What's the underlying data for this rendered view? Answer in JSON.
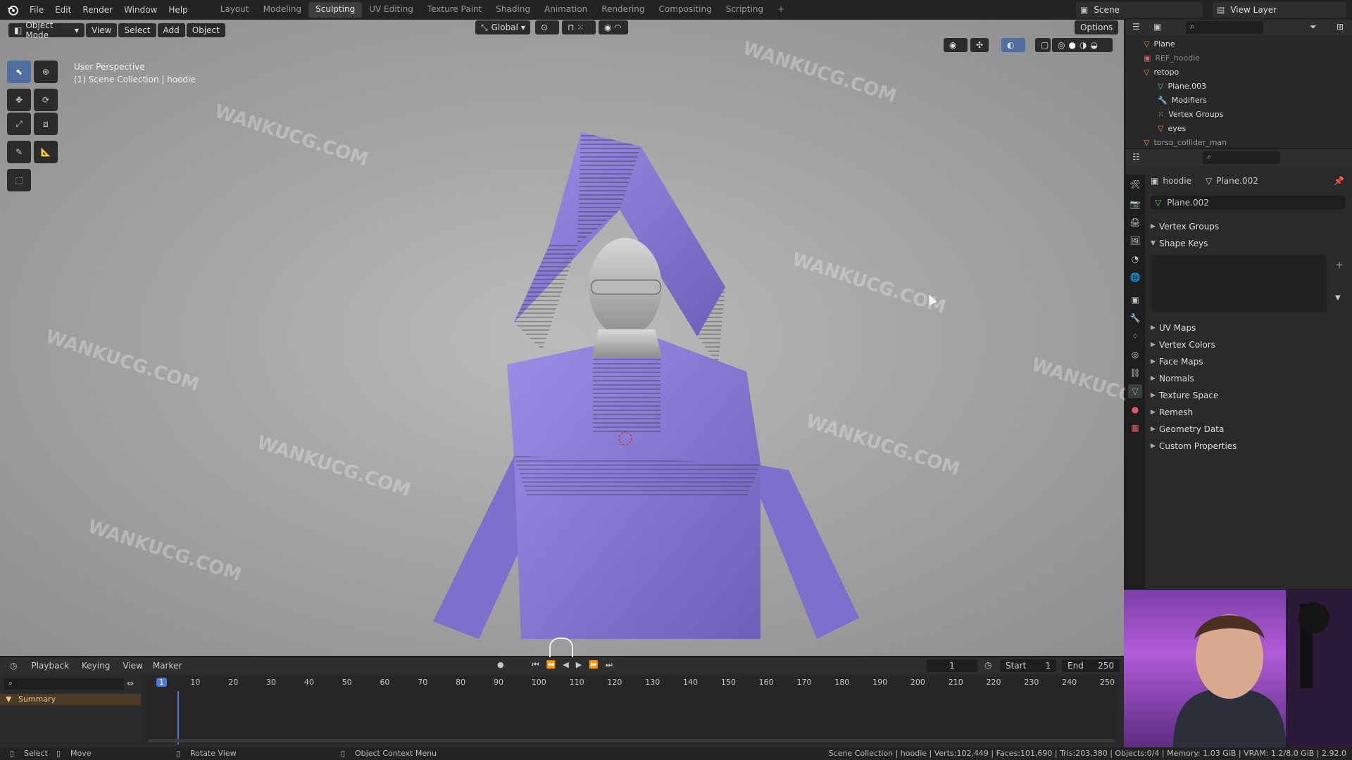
{
  "topbar": {
    "menu": [
      "File",
      "Edit",
      "Render",
      "Window",
      "Help"
    ],
    "workspaces": [
      "Layout",
      "Modeling",
      "Sculpting",
      "UV Editing",
      "Texture Paint",
      "Shading",
      "Animation",
      "Rendering",
      "Compositing",
      "Scripting"
    ],
    "active_workspace": "Sculpting",
    "add_tab": "+",
    "scene_name": "Scene",
    "view_layer": "View Layer"
  },
  "viewport": {
    "mode": "Object Mode",
    "menu": [
      "View",
      "Select",
      "Add",
      "Object"
    ],
    "transform_orientation": "Global",
    "options_label": "Options",
    "perspective_label": "User Perspective",
    "collection_label": "(1) Scene Collection | hoodie"
  },
  "outliner": {
    "rows": [
      {
        "name": "Plane"
      },
      {
        "name": "REF_hoodie"
      },
      {
        "name": "retopo"
      },
      {
        "name": "Plane.003"
      },
      {
        "name": "Modifiers"
      },
      {
        "name": "Vertex Groups"
      },
      {
        "name": "eyes"
      },
      {
        "name": "torso_collider_man"
      }
    ]
  },
  "properties": {
    "object_name": "hoodie",
    "mesh_name": "Plane.002",
    "datablock": "Plane.002",
    "sections": [
      {
        "label": "Vertex Groups",
        "open": false
      },
      {
        "label": "Shape Keys",
        "open": true
      },
      {
        "label": "UV Maps",
        "open": false
      },
      {
        "label": "Vertex Colors",
        "open": false
      },
      {
        "label": "Face Maps",
        "open": false
      },
      {
        "label": "Normals",
        "open": false
      },
      {
        "label": "Texture Space",
        "open": false
      },
      {
        "label": "Remesh",
        "open": false
      },
      {
        "label": "Geometry Data",
        "open": false
      },
      {
        "label": "Custom Properties",
        "open": false
      }
    ]
  },
  "timeline": {
    "menu": [
      "Playback",
      "Keying",
      "View",
      "Marker"
    ],
    "current_frame": "1",
    "start_label": "Start",
    "start": "1",
    "end_label": "End",
    "end": "250",
    "ruler": [
      "1",
      "10",
      "20",
      "30",
      "40",
      "50",
      "60",
      "70",
      "80",
      "90",
      "100",
      "110",
      "120",
      "130",
      "140",
      "150",
      "160",
      "170",
      "180",
      "190",
      "200",
      "210",
      "220",
      "230",
      "240",
      "250"
    ],
    "summary_label": "Summary"
  },
  "statusbar": {
    "select": "Select",
    "move": "Move",
    "rotate": "Rotate View",
    "context": "Object Context Menu",
    "stats": "Scene Collection | hoodie | Verts:102,449 | Faces:101,690 | Tris:203,380 | Objects:0/4 | Memory: 1.03 GiB | VRAM: 1.2/8.0 GiB | 2.92.0"
  },
  "watermark": "WANKUCG.COM",
  "colors": {
    "hoodie": "#8b7fd6",
    "accent": "#4f6fa0",
    "playhead": "#4b7bd4"
  }
}
